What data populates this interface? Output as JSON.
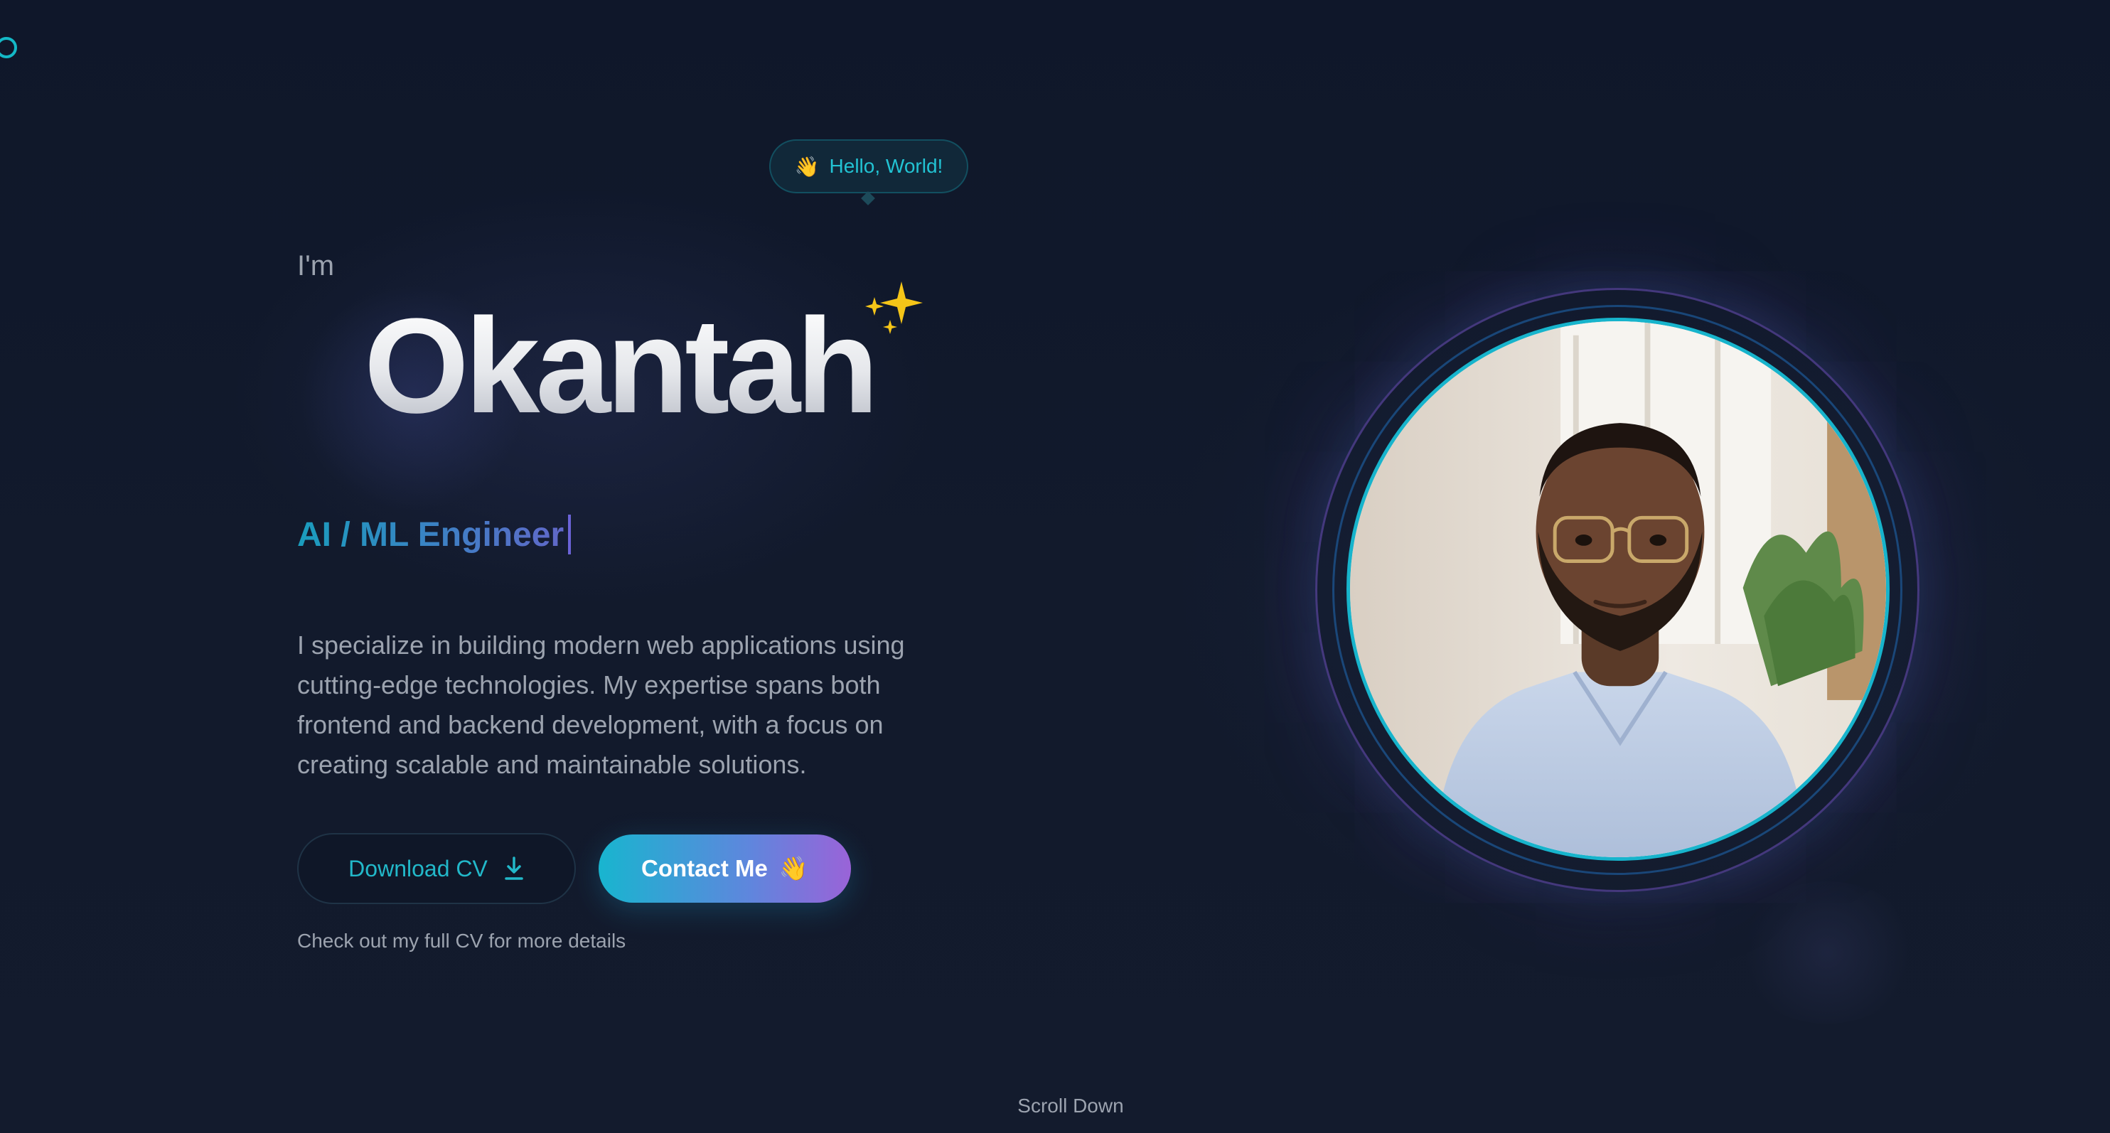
{
  "hero": {
    "greeting_badge": "Hello, World!",
    "greeting_emoji": "👋",
    "intro": "I'm",
    "name": "Okantah",
    "role": "AI / ML Engineer",
    "bio": "I specialize in building modern web applications using cutting-edge technologies. My expertise spans both frontend and backend development, with a focus on creating scalable and maintainable solutions.",
    "download_cv_label": "Download CV",
    "contact_label": "Contact Me",
    "contact_emoji": "👋",
    "cv_note": "Check out my full CV for more details",
    "scroll_label": "Scroll Down"
  },
  "colors": {
    "background": "#111827",
    "accent_cyan": "#14b8c6",
    "accent_purple": "#9a63d8",
    "text_muted": "#9ca3af"
  },
  "icons": {
    "corner": "ring-icon",
    "sparkle": "sparkles-icon",
    "download": "download-icon",
    "wave": "waving-hand-icon"
  }
}
